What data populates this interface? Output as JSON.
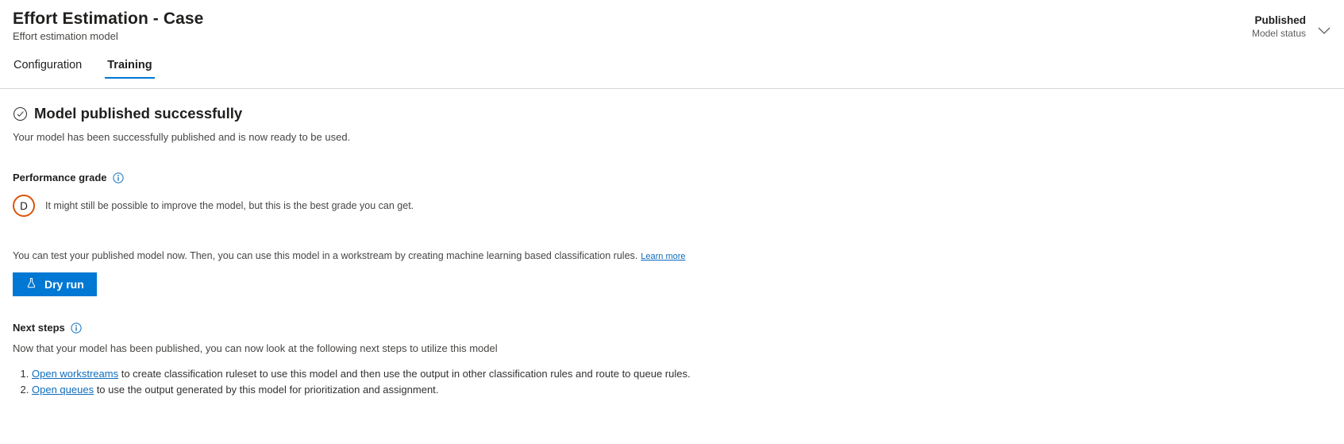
{
  "header": {
    "title": "Effort Estimation - Case",
    "subtitle": "Effort estimation model",
    "status_value": "Published",
    "status_label": "Model status",
    "chevron_icon": "chevron-down-icon"
  },
  "tabs": [
    {
      "label": "Configuration",
      "active": false
    },
    {
      "label": "Training",
      "active": true
    }
  ],
  "main": {
    "success_icon": "check-circle-icon",
    "success_title": "Model published successfully",
    "success_subtitle": "Your model has been successfully published and is now ready to be used.",
    "performance": {
      "label": "Performance grade",
      "info_icon": "info-icon",
      "grade": "D",
      "grade_color": "#d8580c",
      "grade_description": "It might still be possible to improve the model, but this is the best grade you can get."
    },
    "test_text": "You can test your published model now. Then, you can use this model in a workstream by creating machine learning based classification rules.",
    "learn_more_label": "Learn more",
    "dry_run": {
      "label": "Dry run",
      "icon": "flask-icon",
      "color": "#0078d4"
    },
    "next_steps": {
      "label": "Next steps",
      "info_icon": "info-icon",
      "description": "Now that your model has been published, you can now look at the following next steps to utilize this model",
      "items": [
        {
          "link": "Open workstreams",
          "text": " to create classification ruleset to use this model and then use the output in other classification rules and route to queue rules."
        },
        {
          "link": "Open queues",
          "text": " to use the output generated by this model for prioritization and assignment."
        }
      ]
    }
  },
  "colors": {
    "accent": "#0078d4",
    "link": "#0f6cbd",
    "grade": "#d8580c"
  }
}
